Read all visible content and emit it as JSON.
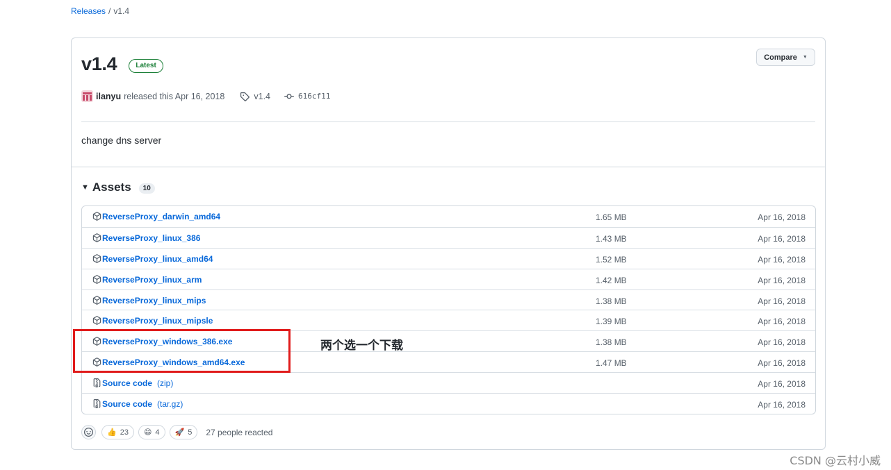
{
  "breadcrumb": {
    "parent": "Releases",
    "separator": "/",
    "current": "v1.4"
  },
  "release": {
    "title": "v1.4",
    "badge": "Latest",
    "compare_label": "Compare",
    "author": "ilanyu",
    "released_text": "released this Apr 16, 2018",
    "tag": "v1.4",
    "commit": "616cf11",
    "body": "change dns server"
  },
  "assets": {
    "title": "Assets",
    "count": "10",
    "items": [
      {
        "name": "ReverseProxy_darwin_amd64",
        "suffix": "",
        "size": "1.65 MB",
        "date": "Apr 16, 2018",
        "icon": "package-icon"
      },
      {
        "name": "ReverseProxy_linux_386",
        "suffix": "",
        "size": "1.43 MB",
        "date": "Apr 16, 2018",
        "icon": "package-icon"
      },
      {
        "name": "ReverseProxy_linux_amd64",
        "suffix": "",
        "size": "1.52 MB",
        "date": "Apr 16, 2018",
        "icon": "package-icon"
      },
      {
        "name": "ReverseProxy_linux_arm",
        "suffix": "",
        "size": "1.42 MB",
        "date": "Apr 16, 2018",
        "icon": "package-icon"
      },
      {
        "name": "ReverseProxy_linux_mips",
        "suffix": "",
        "size": "1.38 MB",
        "date": "Apr 16, 2018",
        "icon": "package-icon"
      },
      {
        "name": "ReverseProxy_linux_mipsle",
        "suffix": "",
        "size": "1.39 MB",
        "date": "Apr 16, 2018",
        "icon": "package-icon"
      },
      {
        "name": "ReverseProxy_windows_386.exe",
        "suffix": "",
        "size": "1.38 MB",
        "date": "Apr 16, 2018",
        "icon": "package-icon"
      },
      {
        "name": "ReverseProxy_windows_amd64.exe",
        "suffix": "",
        "size": "1.47 MB",
        "date": "Apr 16, 2018",
        "icon": "package-icon"
      },
      {
        "name": "Source code",
        "suffix": "(zip)",
        "size": "",
        "date": "Apr 16, 2018",
        "icon": "file-zip-icon"
      },
      {
        "name": "Source code",
        "suffix": "(tar.gz)",
        "size": "",
        "date": "Apr 16, 2018",
        "icon": "file-zip-icon"
      }
    ]
  },
  "reactions": {
    "items": [
      {
        "emoji": "👍",
        "count": "23"
      },
      {
        "emoji": "😄",
        "count": "4"
      },
      {
        "emoji": "🚀",
        "count": "5"
      }
    ],
    "summary": "27 people reacted"
  },
  "annotation": {
    "text": "两个选一个下载",
    "box_color": "#e01b1b"
  },
  "watermark": "CSDN @云村小威",
  "colors": {
    "link": "#0969da",
    "latest": "#1a7f37",
    "muted": "#57606a",
    "border": "#d0d7de"
  }
}
